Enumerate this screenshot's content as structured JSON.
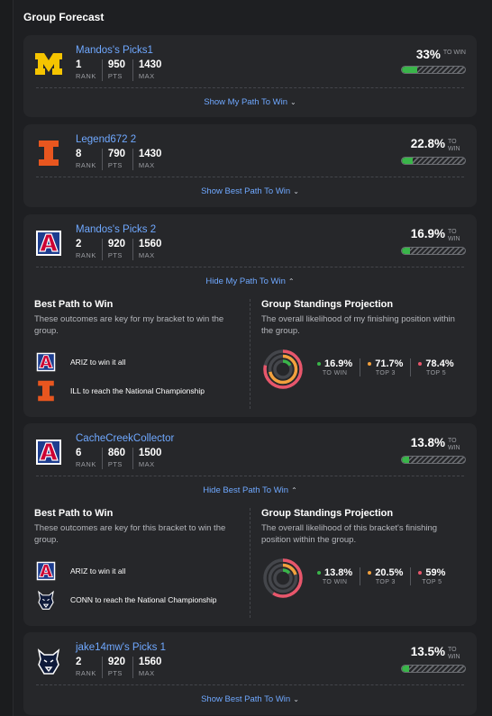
{
  "section": {
    "title": "Group Forecast"
  },
  "labels": {
    "rank": "RANK",
    "pts": "PTS",
    "max": "MAX",
    "to_win": "TO WIN",
    "top3": "TOP 3",
    "top5": "TOP 5"
  },
  "colors": {
    "link": "#6fa8ff",
    "bar_fill": "#3ab54a",
    "to_win_dot": "#3ab54a",
    "top3_dot": "#f2a03d",
    "top5_dot": "#e8566b"
  },
  "cards": [
    {
      "name": "Mandos's Picks1",
      "team": "michigan-logo",
      "rank": "1",
      "pts": "950",
      "max": "1430",
      "pct": "33%",
      "to_win_fraction": 0.33,
      "toggle": "Show My Path To Win",
      "expanded": false
    },
    {
      "name": "Legend672 2",
      "team": "illinois-logo",
      "rank": "8",
      "pts": "790",
      "max": "1430",
      "pct": "22.8%",
      "to_win_fraction": 0.228,
      "toggle": "Show Best Path To Win",
      "expanded": false
    },
    {
      "name": "Mandos's Picks 2",
      "team": "arizona-logo",
      "rank": "2",
      "pts": "920",
      "max": "1560",
      "pct": "16.9%",
      "to_win_fraction": 0.169,
      "toggle": "Hide My Path To Win",
      "expanded": true,
      "best_path_title": "Best Path to Win",
      "best_path_desc": "These outcomes are key for my bracket to win the group.",
      "paths": [
        {
          "icon": "arizona-logo",
          "text": "ARIZ to win it all"
        },
        {
          "icon": "illinois-logo",
          "text": "ILL to reach the National Championship"
        }
      ],
      "proj_title": "Group Standings Projection",
      "proj_desc": "The overall likelihood of my finishing position within the group.",
      "proj": {
        "to_win": "16.9%",
        "top3": "71.7%",
        "top5": "78.4%",
        "to_win_frac": 0.169,
        "top3_frac": 0.717,
        "top5_frac": 0.784
      }
    },
    {
      "name": "CacheCreekCollector",
      "team": "arizona-logo",
      "rank": "6",
      "pts": "860",
      "max": "1500",
      "pct": "13.8%",
      "to_win_fraction": 0.138,
      "toggle": "Hide Best Path To Win",
      "expanded": true,
      "best_path_title": "Best Path to Win",
      "best_path_desc": "These outcomes are key for this bracket to win the group.",
      "paths": [
        {
          "icon": "arizona-logo",
          "text": "ARIZ to win it all"
        },
        {
          "icon": "uconn-logo",
          "text": "CONN to reach the National Championship"
        }
      ],
      "proj_title": "Group Standings Projection",
      "proj_desc": "The overall likelihood of this bracket's finishing position within the group.",
      "proj": {
        "to_win": "13.8%",
        "top3": "20.5%",
        "top5": "59%",
        "to_win_frac": 0.138,
        "top3_frac": 0.205,
        "top5_frac": 0.59
      }
    },
    {
      "name": "jake14mw's Picks 1",
      "team": "uconn-logo",
      "rank": "2",
      "pts": "920",
      "max": "1560",
      "pct": "13.5%",
      "to_win_fraction": 0.135,
      "toggle": "Show Best Path To Win",
      "expanded": false
    }
  ]
}
